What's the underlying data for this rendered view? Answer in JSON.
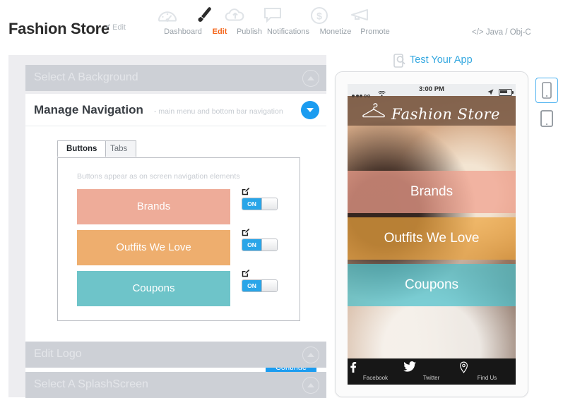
{
  "header": {
    "app_title": "Fashion Store",
    "edit_link": "Edit",
    "code_flag": "</> Java / Obj-C",
    "nav": [
      {
        "label": "Dashboard",
        "icon": "gauge-icon",
        "active": false
      },
      {
        "label": "Edit",
        "icon": "paintbrush-icon",
        "active": true
      },
      {
        "label": "Publish",
        "icon": "cloud-upload-icon",
        "active": false
      },
      {
        "label": "Notifications",
        "icon": "chat-bubble-icon",
        "active": false
      },
      {
        "label": "Monetize",
        "icon": "dollar-circle-icon",
        "active": false
      },
      {
        "label": "Promote",
        "icon": "megaphone-icon",
        "active": false
      }
    ]
  },
  "accordion": {
    "background": {
      "title": "Select A Background",
      "state": "collapsed",
      "chevron": "chevron-up-icon"
    },
    "navigation": {
      "title": "Manage Navigation",
      "subtitle": "- main menu and bottom bar navigation",
      "state": "expanded",
      "chevron": "chevron-down-icon",
      "tabs": [
        {
          "label": "Buttons",
          "selected": true
        },
        {
          "label": "Tabs",
          "selected": false
        }
      ],
      "hint": "Buttons appear as on screen navigation elements",
      "buttons": [
        {
          "label": "Brands",
          "color": "#eeac99",
          "toggle": "ON",
          "edit_icon": "edit-square-icon"
        },
        {
          "label": "Outfits We Love",
          "color": "#eeae6e",
          "toggle": "ON",
          "edit_icon": "edit-square-icon"
        },
        {
          "label": "Coupons",
          "color": "#6ec4c9",
          "toggle": "ON",
          "edit_icon": "edit-square-icon"
        }
      ],
      "continue_label": "Continue"
    },
    "logo": {
      "title": "Edit Logo",
      "state": "collapsed",
      "chevron": "chevron-up-icon"
    },
    "splash": {
      "title": "Select A SplashScreen",
      "state": "collapsed",
      "chevron": "chevron-up-icon"
    }
  },
  "preview": {
    "test_link": "Test Your App",
    "test_icon": "device-search-icon",
    "status_bar": {
      "signal_dots_filled": 3,
      "signal_dots_empty": 2,
      "wifi": "wifi-icon",
      "time": "3:00 PM",
      "location": "location-arrow-icon",
      "battery": "battery-icon"
    },
    "app_bar": {
      "logo_icon": "clothes-hanger-icon",
      "title": "Fashion Store"
    },
    "buttons": [
      {
        "label": "Brands",
        "color": "#f0a08e"
      },
      {
        "label": "Outfits We Love",
        "color": "#eba43f"
      },
      {
        "label": "Coupons",
        "color": "#4cc0cc"
      }
    ],
    "tab_bar": [
      {
        "label": "Facebook",
        "icon": "facebook-icon"
      },
      {
        "label": "Twitter",
        "icon": "twitter-icon"
      },
      {
        "label": "Find Us",
        "icon": "map-pin-icon"
      }
    ]
  },
  "device_selector": [
    {
      "name": "phone",
      "icon": "phone-icon",
      "selected": true
    },
    {
      "name": "tablet",
      "icon": "tablet-icon",
      "selected": false
    }
  ],
  "colors": {
    "accent_blue": "#1b9cf0",
    "accent_orange": "#f4661b",
    "link_blue": "#35a8e0"
  }
}
